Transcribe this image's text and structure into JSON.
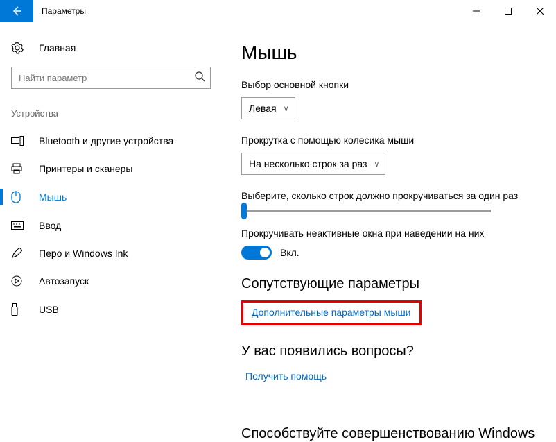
{
  "window": {
    "title": "Параметры"
  },
  "sidebar": {
    "home": "Главная",
    "search_placeholder": "Найти параметр",
    "section": "Устройства",
    "items": [
      {
        "label": "Bluetooth и другие устройства"
      },
      {
        "label": "Принтеры и сканеры"
      },
      {
        "label": "Мышь"
      },
      {
        "label": "Ввод"
      },
      {
        "label": "Перо и Windows Ink"
      },
      {
        "label": "Автозапуск"
      },
      {
        "label": "USB"
      }
    ]
  },
  "main": {
    "title": "Мышь",
    "primary_button_label": "Выбор основной кнопки",
    "primary_button_value": "Левая",
    "scroll_mode_label": "Прокрутка с помощью колесика мыши",
    "scroll_mode_value": "На несколько строк за раз",
    "lines_label": "Выберите, сколько строк должно прокручиваться за один раз",
    "inactive_label": "Прокручивать неактивные окна при наведении на них",
    "toggle_on_text": "Вкл.",
    "related_heading": "Сопутствующие параметры",
    "related_link": "Дополнительные параметры мыши",
    "help_heading": "У вас появились вопросы?",
    "help_link": "Получить помощь",
    "cutoff_heading": "Способствуйте совершенствованию Windows"
  }
}
